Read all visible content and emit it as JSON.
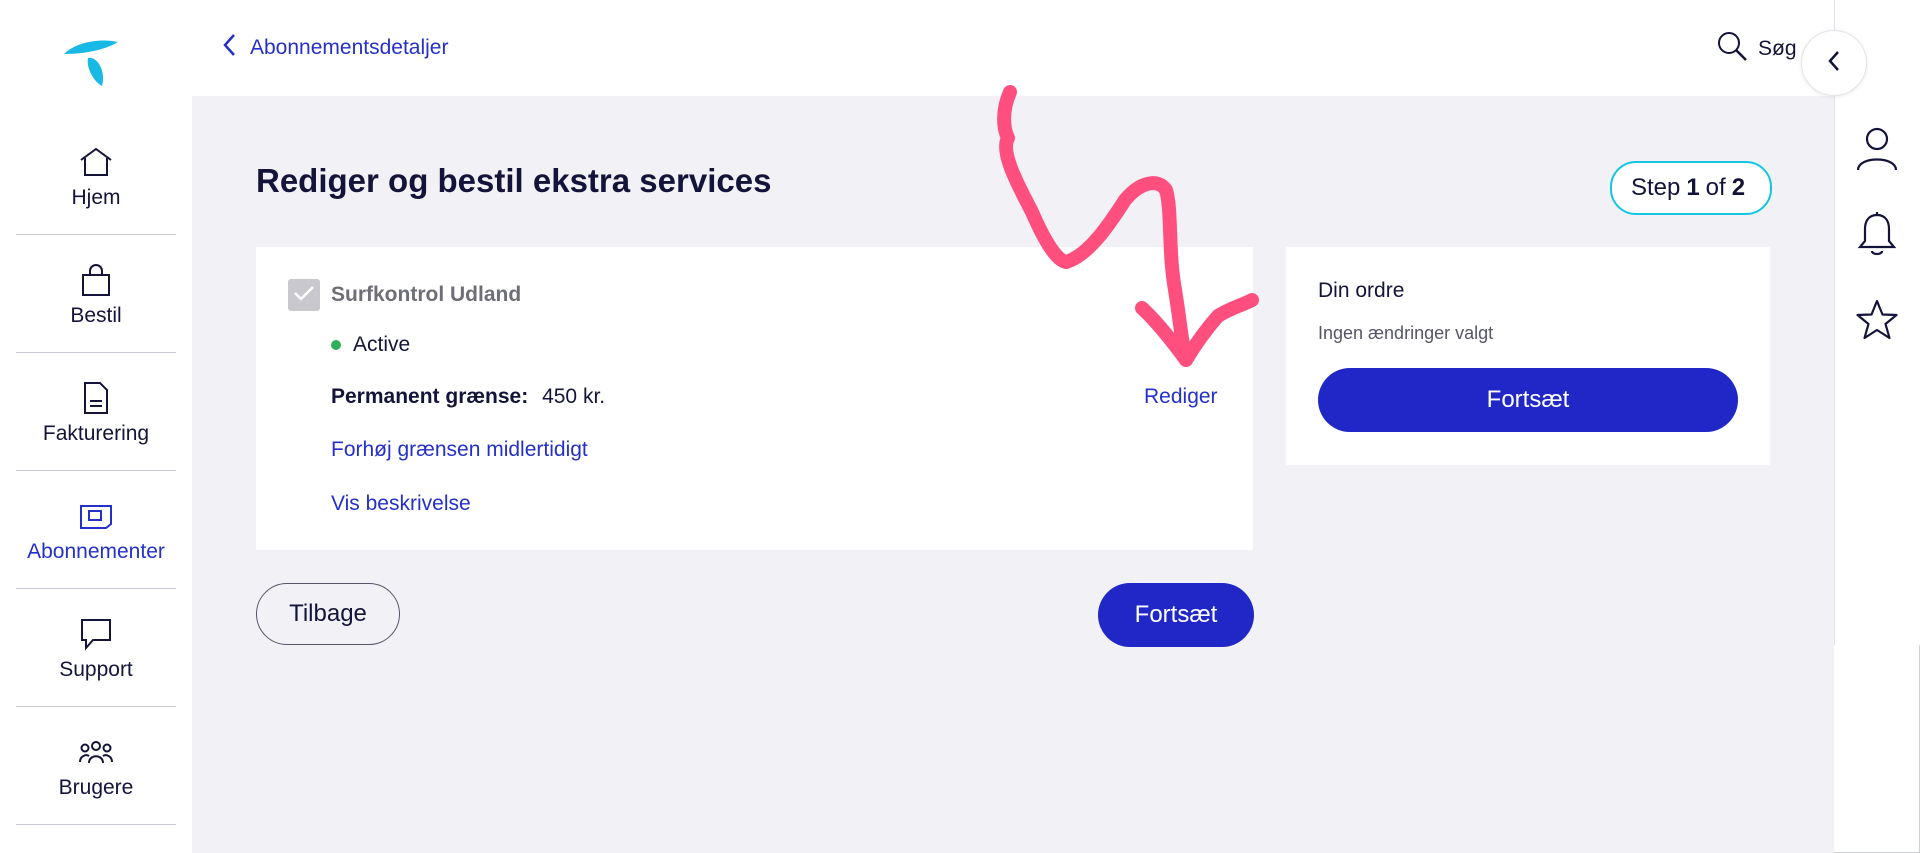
{
  "sidebar": {
    "items": [
      {
        "label": "Hjem",
        "icon": "home-icon"
      },
      {
        "label": "Bestil",
        "icon": "shopping-bag-icon"
      },
      {
        "label": "Fakturering",
        "icon": "document-icon"
      },
      {
        "label": "Abonnementer",
        "icon": "sim-card-icon",
        "active": true
      },
      {
        "label": "Support",
        "icon": "chat-bubble-icon"
      },
      {
        "label": "Brugere",
        "icon": "users-icon"
      }
    ]
  },
  "header": {
    "back_label": "Abonnementsdetaljer",
    "search_label": "Søg"
  },
  "main": {
    "title": "Rediger og bestil ekstra services",
    "step": {
      "prefix": "Step",
      "current": "1",
      "of": "of",
      "total": "2"
    }
  },
  "service": {
    "name": "Surfkontrol Udland",
    "checked": true,
    "status": "Active",
    "limit_label": "Permanent grænse:",
    "limit_value": "450 kr.",
    "edit_label": "Rediger",
    "raise_link": "Forhøj grænsen midlertidigt",
    "description_link": "Vis beskrivelse"
  },
  "actions": {
    "back_label": "Tilbage",
    "continue_label": "Fortsæt"
  },
  "order": {
    "title": "Din ordre",
    "subtitle": "Ingen ændringer valgt",
    "button_label": "Fortsæt"
  },
  "colors": {
    "primary": "#2127c7",
    "link": "#2430c9",
    "accent_teal": "#14c6e0",
    "logo": "#19b9e6",
    "status_active": "#2eb05b",
    "annotation": "#ff4f7f",
    "background": "#f2f2f6"
  },
  "right_rail": {
    "icons": [
      "user-icon",
      "bell-icon",
      "star-icon"
    ]
  }
}
